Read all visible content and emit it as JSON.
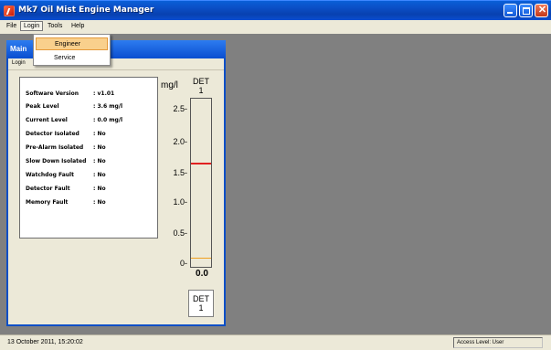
{
  "window": {
    "title": "Mk7 Oil Mist Engine Manager"
  },
  "menubar": {
    "file": "File",
    "login": "Login",
    "tools": "Tools",
    "help": "Help"
  },
  "login_menu": {
    "items": [
      "Engineer",
      "Service"
    ]
  },
  "child_window": {
    "title": "Main",
    "menu": {
      "login": "Login",
      "partial": ""
    }
  },
  "status": {
    "rows": [
      {
        "label": "Software Version",
        "value": ": v1.01"
      },
      {
        "label": "Peak Level",
        "value": ": 3.6 mg/l"
      },
      {
        "label": "Current Level",
        "value": ": 0.0 mg/l"
      },
      {
        "label": "Detector Isolated",
        "value": ": No"
      },
      {
        "label": "Pre-Alarm Isolated",
        "value": ": No"
      },
      {
        "label": "Slow Down Isolated",
        "value": ": No"
      },
      {
        "label": "Watchdog Fault",
        "value": ": No"
      },
      {
        "label": "Detector Fault",
        "value": ": No"
      },
      {
        "label": "Memory Fault",
        "value": ": No"
      }
    ]
  },
  "gauge": {
    "unit": "mg/l",
    "header_line1": "DET",
    "header_line2": "1",
    "ticks": [
      "2.5-",
      "2.0-",
      "1.5-",
      "1.0-",
      "0.5-",
      "0-"
    ],
    "reading": "0.0",
    "button_line1": "DET",
    "button_line2": "1",
    "alarm_color": "#e02020",
    "prealarm_color": "#f0a020"
  },
  "statusbar": {
    "datetime": "13 October 2011, 15:20:02",
    "access": "Access Level: User"
  }
}
